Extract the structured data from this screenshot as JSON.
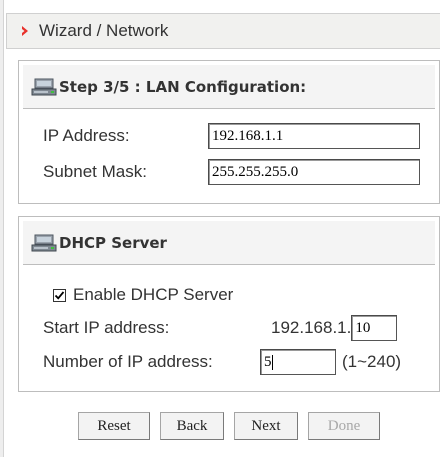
{
  "header": {
    "title": "Wizard / Network"
  },
  "lan": {
    "heading": "Step 3/5 : LAN Configuration:",
    "ip_label": "IP Address:",
    "ip_value": "192.168.1.1",
    "mask_label": "Subnet Mask:",
    "mask_value": "255.255.255.0"
  },
  "dhcp": {
    "heading": "DHCP Server",
    "enable_label": "Enable DHCP Server",
    "enable_checked": true,
    "start_label": "Start IP address:",
    "start_prefix": "192.168.1.",
    "start_value": "10",
    "count_label": "Number of IP address:",
    "count_value": "5",
    "count_hint": "(1~240)"
  },
  "buttons": {
    "reset": "Reset",
    "back": "Back",
    "next": "Next",
    "done": "Done"
  },
  "icons": {
    "title_arrow": "red-chevron-right-icon",
    "section_icon": "computer-icon"
  },
  "colors": {
    "accent": "#e8312b",
    "border": "#bdbdbd",
    "header_bg": "#f1f1ef"
  }
}
